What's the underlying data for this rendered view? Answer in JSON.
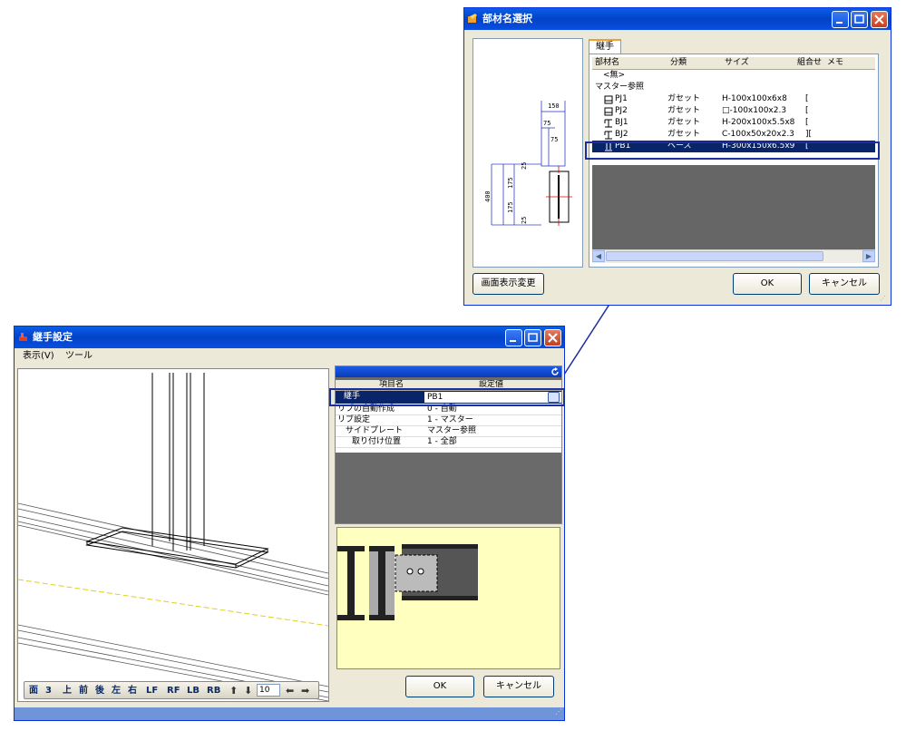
{
  "member_dialog": {
    "title": "部材名選択",
    "tab": "継手",
    "columns": [
      "部材名",
      "分類",
      "サイズ",
      "組合せ",
      "メモ"
    ],
    "rows": [
      {
        "name": "<無>",
        "cls": "",
        "size": "",
        "combo": ""
      },
      {
        "name": "マスター参照",
        "cls": "",
        "size": "",
        "combo": ""
      },
      {
        "name": "PJ1",
        "cls": "ガセット",
        "size": "H-100x100x6x8",
        "combo": "["
      },
      {
        "name": "PJ2",
        "cls": "ガセット",
        "size": "□-100x100x2.3",
        "combo": "["
      },
      {
        "name": "BJ1",
        "cls": "ガセット",
        "size": "H-200x100x5.5x8",
        "combo": "["
      },
      {
        "name": "BJ2",
        "cls": "ガセット",
        "size": "C-100x50x20x2.3",
        "combo": "]["
      },
      {
        "name": "PB1",
        "cls": "ベース",
        "size": "H-300x150x6.5x9",
        "combo": "["
      }
    ],
    "preview_dims": [
      "150",
      "75",
      "75",
      "400",
      "175",
      "175",
      "25",
      "25"
    ],
    "display_button": "画面表示変更",
    "ok": "OK",
    "cancel": "キャンセル"
  },
  "joint_dialog": {
    "title": "継手設定",
    "menu": [
      "表示(V)",
      "ツール"
    ],
    "prop_headers": [
      "項目名",
      "設定値"
    ],
    "props": [
      {
        "name": "継手",
        "value": "PB1"
      },
      {
        "name": "リブの自動作成",
        "value": "0 - 自動"
      },
      {
        "name": "リブ設定",
        "value": "1 - マスター"
      },
      {
        "name": "サイドプレート",
        "value": "マスター参照"
      },
      {
        "name": "取り付け位置",
        "value": "1 - 全部"
      }
    ],
    "view_toolbar": [
      "面",
      "3",
      "上",
      "前",
      "後",
      "左",
      "右",
      "LF",
      "RF",
      "LB",
      "RB"
    ],
    "zoom_value": "10",
    "ok": "OK",
    "cancel": "キャンセル"
  },
  "colors": {
    "selection": "#0a246a",
    "highlight": "#1c2fa0",
    "preview_bg": "#ffffc0"
  }
}
